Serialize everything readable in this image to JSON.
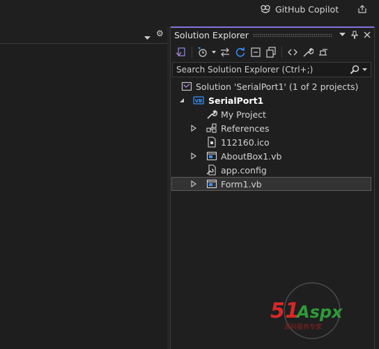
{
  "titlebar": {
    "copilot_label": "GitHub Copilot"
  },
  "solution_explorer": {
    "title": "Solution Explorer",
    "search_placeholder": "Search Solution Explorer (Ctrl+;)",
    "tree": [
      {
        "label": "Solution 'SerialPort1' (1 of 2 projects)",
        "icon": "solution-icon",
        "expander": "none"
      },
      {
        "label": "SerialPort1",
        "icon": "vb-project-icon",
        "expander": "expanded",
        "bold": true
      },
      {
        "label": "My Project",
        "icon": "wrench-icon",
        "expander": "none"
      },
      {
        "label": "References",
        "icon": "references-icon",
        "expander": "collapsed"
      },
      {
        "label": "112160.ico",
        "icon": "ico-file-icon",
        "expander": "none"
      },
      {
        "label": "AboutBox1.vb",
        "icon": "form-file-icon",
        "expander": "collapsed"
      },
      {
        "label": "app.config",
        "icon": "config-file-icon",
        "expander": "none"
      },
      {
        "label": "Form1.vb",
        "icon": "form-file-icon",
        "expander": "collapsed",
        "selected": true
      }
    ]
  },
  "watermark": {
    "brand_red": "51",
    "brand_rest": "Aspx",
    "subtitle": "源码服务专家"
  },
  "colors": {
    "accent": "#8673e0",
    "background": "#1f1f1f",
    "selection": "#333333"
  }
}
